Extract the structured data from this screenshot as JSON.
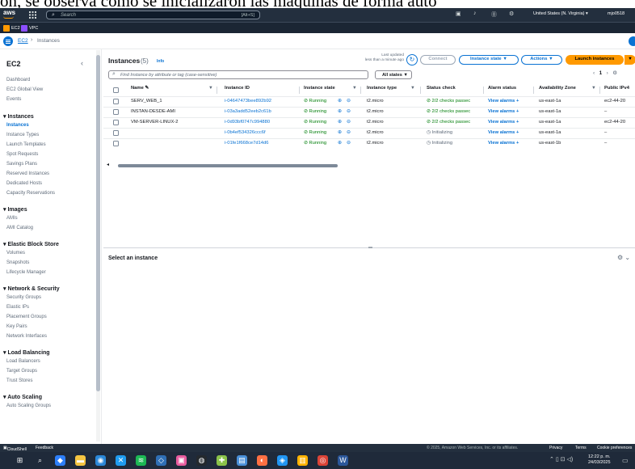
{
  "caption": "on, se observa como se inicializaron las máquinas de forma auto",
  "topnav": {
    "logo": "aws",
    "search_placeholder": "Search",
    "search_shortcut": "[Alt+S]",
    "region": "United States (N. Virginia) ▾",
    "user": "mjo0518"
  },
  "services": [
    {
      "label": "EC2",
      "color": "#ff9900"
    },
    {
      "label": "VPC",
      "color": "#8c4fff"
    }
  ],
  "breadcrumb": {
    "parent": "EC2",
    "current": "Instances"
  },
  "sidebar": {
    "title": "EC2",
    "top_items": [
      "Dashboard",
      "EC2 Global View",
      "Events"
    ],
    "sections": [
      {
        "heading": "Instances",
        "items": [
          "Instances",
          "Instance Types",
          "Launch Templates",
          "Spot Requests",
          "Savings Plans",
          "Reserved Instances",
          "Dedicated Hosts",
          "Capacity Reservations"
        ]
      },
      {
        "heading": "Images",
        "items": [
          "AMIs",
          "AMI Catalog"
        ]
      },
      {
        "heading": "Elastic Block Store",
        "items": [
          "Volumes",
          "Snapshots",
          "Lifecycle Manager"
        ]
      },
      {
        "heading": "Network & Security",
        "items": [
          "Security Groups",
          "Elastic IPs",
          "Placement Groups",
          "Key Pairs",
          "Network Interfaces"
        ]
      },
      {
        "heading": "Load Balancing",
        "items": [
          "Load Balancers",
          "Target Groups",
          "Trust Stores"
        ]
      },
      {
        "heading": "Auto Scaling",
        "items": [
          "Auto Scaling Groups"
        ]
      }
    ]
  },
  "main": {
    "title": "Instances",
    "count": "(5)",
    "info": "Info",
    "last_updated": "Last updated",
    "last_updated_when": "less than a minute ago",
    "connect": "Connect",
    "instance_state": "Instance state ▼",
    "actions": "Actions ▼",
    "launch": "Launch instances",
    "find_placeholder": "Find Instance by attribute or tag (case-sensitive)",
    "states_filter": "All states ▼",
    "page": "1",
    "columns": [
      "Name ✎",
      "Instance ID",
      "Instance state",
      "Instance type",
      "Status check",
      "Alarm status",
      "Availability Zone",
      "Public IPv4"
    ],
    "rows": [
      {
        "name": "SERV_WEB_1",
        "id": "i-04647473bee892b92",
        "state": "Running",
        "type": "t2.micro",
        "status": "2/2 checks passec",
        "status_ok": true,
        "alarm": "View alarms",
        "az": "us-east-1a",
        "ip": "ec2-44-20"
      },
      {
        "name": "INSTAN-DESDE-AMI",
        "id": "i-03a3add52eeb2c61b",
        "state": "Running",
        "type": "t2.micro",
        "status": "2/2 checks passec",
        "status_ok": true,
        "alarm": "View alarms",
        "az": "us-east-1a",
        "ip": "–"
      },
      {
        "name": "VM-SERVER-LINUX-2",
        "id": "i-0d93bf0747c994880",
        "state": "Running",
        "type": "t2.micro",
        "status": "2/2 checks passec",
        "status_ok": true,
        "alarm": "View alarms",
        "az": "us-east-1a",
        "ip": "ec2-44-20"
      },
      {
        "name": "",
        "id": "i-0b4ef534326ccc6f",
        "state": "Running",
        "type": "t2.micro",
        "status": "Initializing",
        "status_ok": false,
        "alarm": "View alarms",
        "az": "us-east-1a",
        "ip": "–"
      },
      {
        "name": "",
        "id": "i-01fe1f668ce7d14d6",
        "state": "Running",
        "type": "t2.micro",
        "status": "Initializing",
        "status_ok": false,
        "alarm": "View alarms",
        "az": "us-east-1b",
        "ip": "–"
      }
    ],
    "select_title": "Select an instance"
  },
  "footer": {
    "cloudshell": "CloudShell",
    "feedback": "Feedback",
    "copyright": "© 2025, Amazon Web Services, Inc. or its affiliates.",
    "privacy": "Privacy",
    "terms": "Terms",
    "cookies": "Cookie preferences"
  },
  "taskbar": {
    "time": "12:22 p. m.",
    "date": "24/03/2025",
    "apps": [
      {
        "icon": "windows-icon",
        "color": "#1f2a3a",
        "glyph": "⊞"
      },
      {
        "icon": "search-icon",
        "color": "#1f2a3a",
        "glyph": "⌕"
      },
      {
        "icon": "app-icon",
        "color": "#2d7ff9",
        "glyph": "◆"
      },
      {
        "icon": "file-explorer-icon",
        "color": "#f4c542",
        "glyph": "▬"
      },
      {
        "icon": "browser-icon",
        "color": "#2b88d8",
        "glyph": "◉"
      },
      {
        "icon": "vscode-icon",
        "color": "#1f9cf0",
        "glyph": "✕"
      },
      {
        "icon": "spotify-icon",
        "color": "#1db954",
        "glyph": "≋"
      },
      {
        "icon": "app-icon",
        "color": "#2f6fb5",
        "glyph": "◇"
      },
      {
        "icon": "app-icon",
        "color": "#e85d9f",
        "glyph": "▣"
      },
      {
        "icon": "github-icon",
        "color": "#24292e",
        "glyph": "◍"
      },
      {
        "icon": "app-icon",
        "color": "#8bc34a",
        "glyph": "✚"
      },
      {
        "icon": "app-icon",
        "color": "#4a90d9",
        "glyph": "▤"
      },
      {
        "icon": "app-icon",
        "color": "#ff7043",
        "glyph": "◐"
      },
      {
        "icon": "app-icon",
        "color": "#2196f3",
        "glyph": "◈"
      },
      {
        "icon": "app-icon",
        "color": "#ffb300",
        "glyph": "▥"
      },
      {
        "icon": "chrome-icon",
        "color": "#db4437",
        "glyph": "◎"
      },
      {
        "icon": "word-icon",
        "color": "#2b579a",
        "glyph": "W"
      }
    ]
  }
}
